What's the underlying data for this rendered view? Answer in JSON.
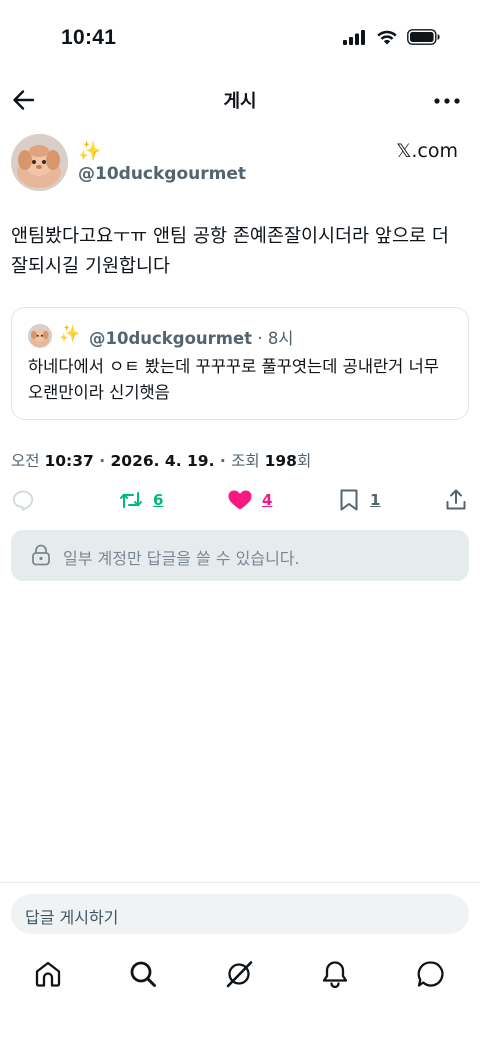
{
  "status_bar": {
    "time": "10:41"
  },
  "header": {
    "title": "게시"
  },
  "author": {
    "emoji": "✨",
    "handle": "@10duckgourmet",
    "source": "𝕏.com"
  },
  "post": {
    "text": "앤팀봤다고요ㅜㅠ 앤팀 공항 존예존잘이시더라 앞으로 더 잘되시길 기원합니다"
  },
  "quote": {
    "emoji": "✨",
    "handle": "@10duckgourmet",
    "time": " · 8시",
    "text": "하네다에서 ㅇㅌ 봤는데 꾸꾸꾸로 풀꾸엿는데 공내란거 너무 오랜만이라 신기햇음"
  },
  "meta": {
    "ampm": "오전",
    "time": "10:37",
    "sep1": " · ",
    "date": "2026. 4. 19.",
    "sep2": " · ",
    "views_label": "조회",
    "views": "198",
    "views_unit": "회"
  },
  "actions": {
    "retweets": "6",
    "likes": "4",
    "bookmarks": "1"
  },
  "colors": {
    "retweet": "#00ba7c",
    "like": "#f91880",
    "muted": "#536471"
  },
  "restriction": {
    "text": "일부 계정만 답글을 쓸 수 있습니다."
  },
  "reply_box": {
    "placeholder": "답글 게시하기"
  },
  "tabbar": {
    "items": [
      "home-icon",
      "search-icon",
      "grok-icon",
      "notifications-icon",
      "messages-icon"
    ]
  }
}
